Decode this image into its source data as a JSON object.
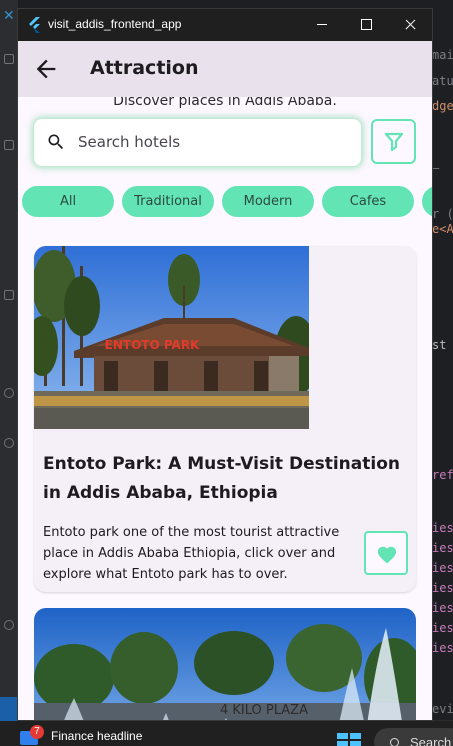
{
  "window": {
    "title": "visit_addis_frontend_app"
  },
  "appbar": {
    "title": "Attraction"
  },
  "page": {
    "subtitle": "Discover places in Addis Ababa."
  },
  "search": {
    "placeholder": "Search hotels",
    "value": ""
  },
  "chips": [
    {
      "label": "All"
    },
    {
      "label": "Traditional"
    },
    {
      "label": "Modern"
    },
    {
      "label": "Cafes"
    }
  ],
  "cards": [
    {
      "title": "Entoto Park: A Must-Visit Destination in Addis Ababa, Ethiopia",
      "description": "Entoto park one of the most tourist attractive place in Addis Ababa Ethiopia, click over and explore what Entoto park has to over.",
      "image_sign": "ENTOTO PARK"
    },
    {
      "image_sign": "4 KILO PLAZA"
    }
  ],
  "taskbar": {
    "news_badge": "7",
    "news_text": "Finance headline",
    "search_label": "Search"
  },
  "background": {
    "code_fragments": [
      "main",
      "atur",
      "dge",
      "_",
      "r (Yo",
      "e<A",
      "st",
      "ref",
      "ies",
      "ies",
      "ies",
      "ies",
      "ies",
      "ies",
      "ies",
      "evie"
    ]
  },
  "colors": {
    "accent": "#62e4b5",
    "appbar": "#e9e1ec",
    "surface": "#fdf7ff",
    "card": "#f5eff8",
    "titlebar": "#1f1f1f"
  },
  "icons": {
    "back": "arrow-back-icon",
    "search": "search-icon",
    "filter": "filter-icon",
    "favorite": "heart-icon"
  }
}
